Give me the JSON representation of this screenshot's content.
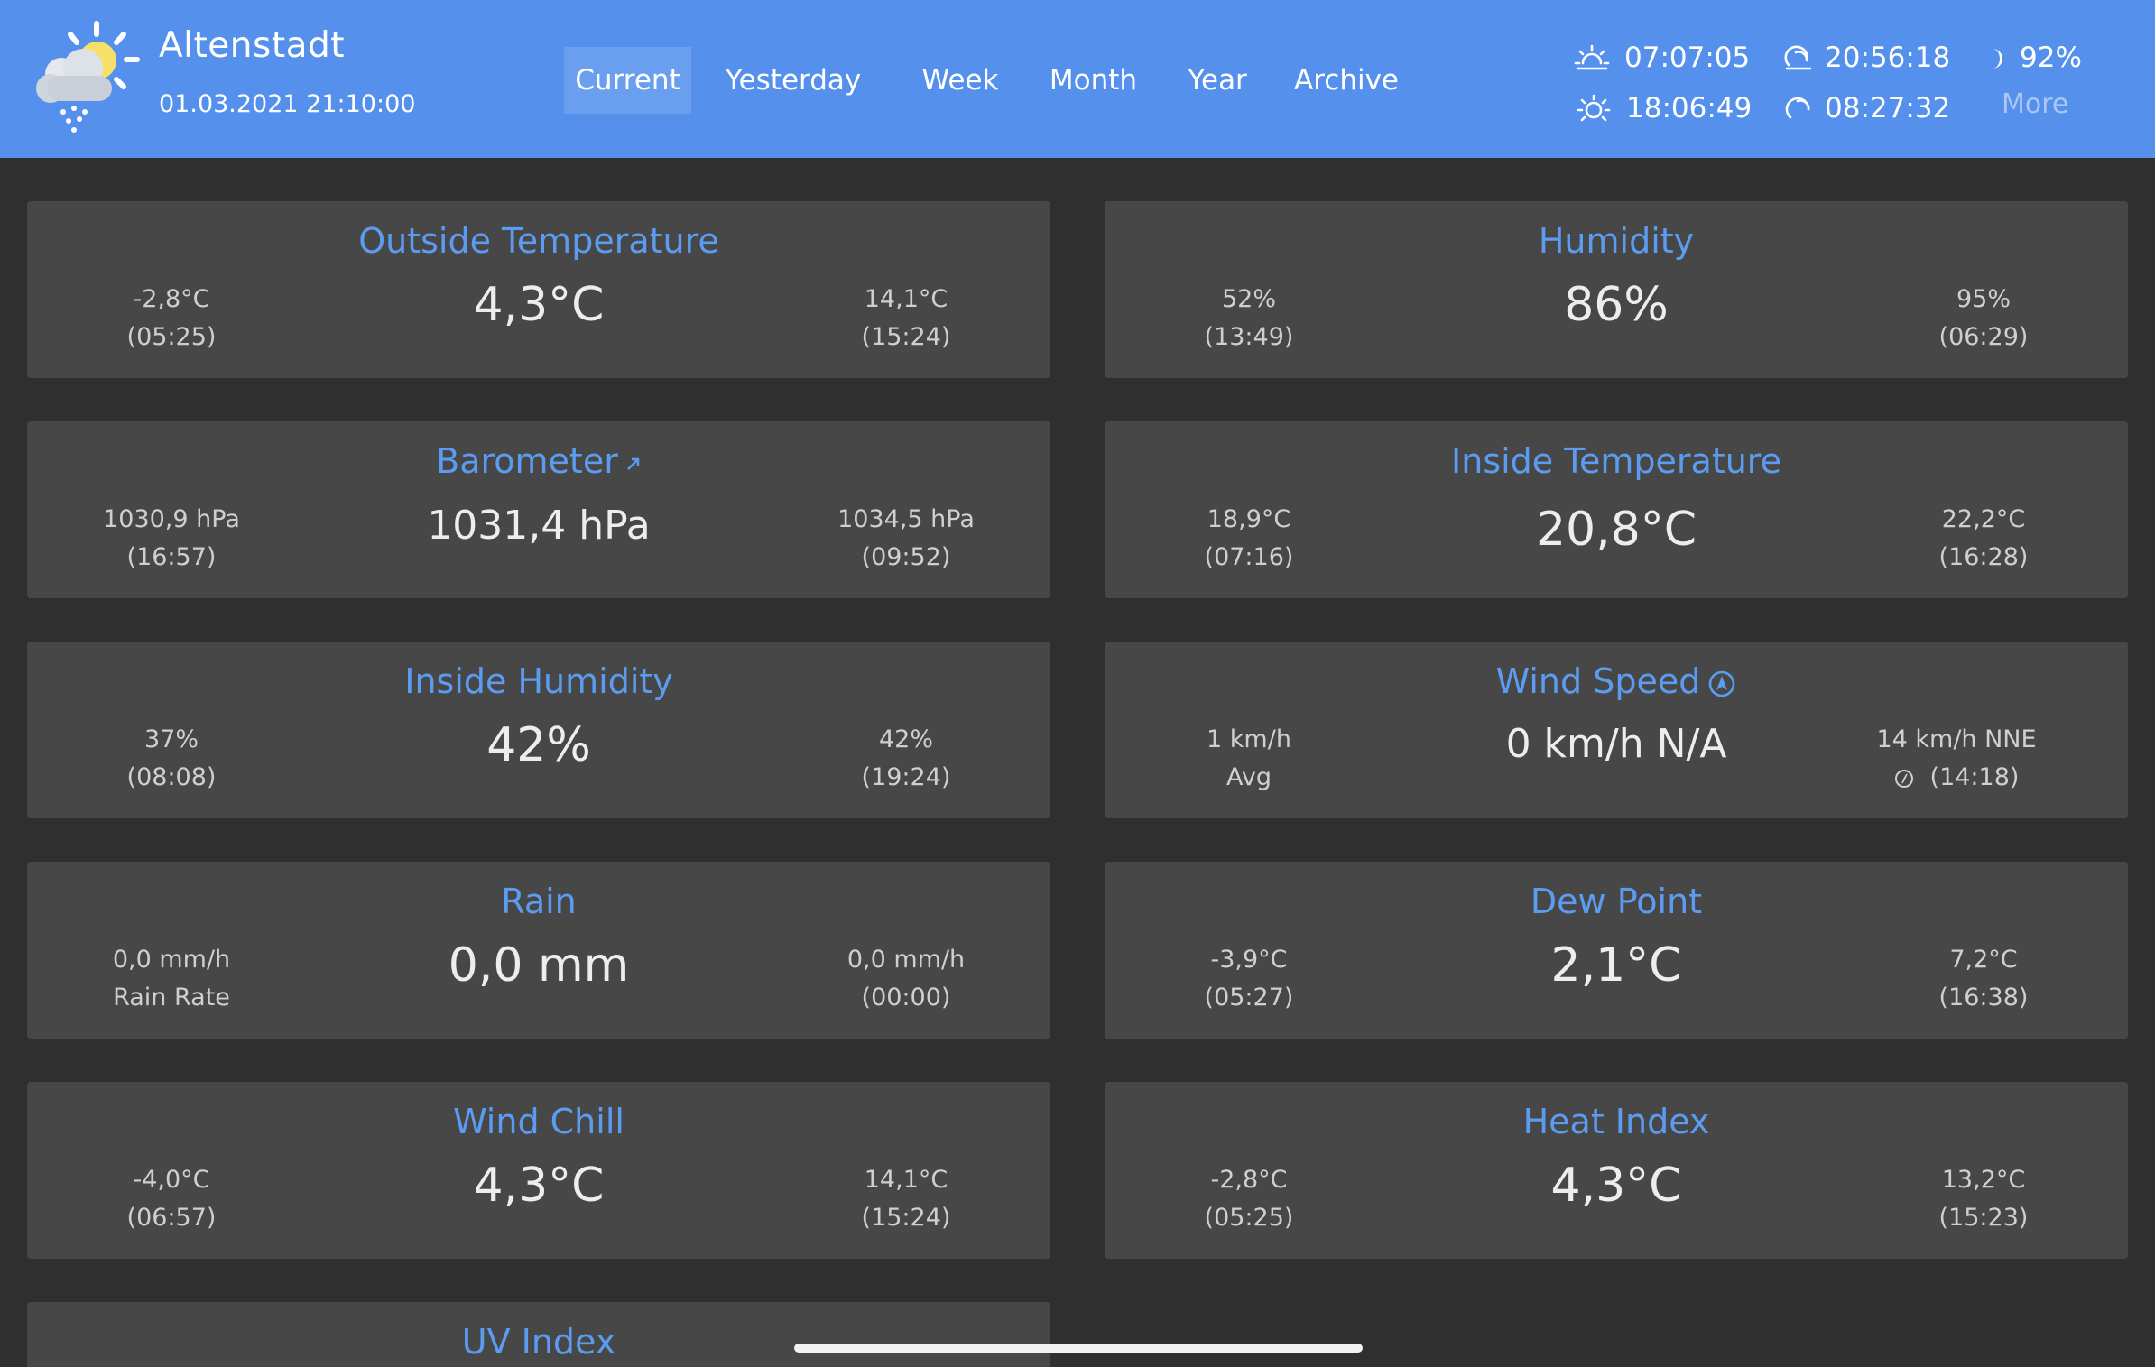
{
  "header": {
    "station": "Altenstadt",
    "datetime": "01.03.2021 21:10:00",
    "nav": [
      {
        "label": "Current",
        "active": true
      },
      {
        "label": "Yesterday",
        "active": false
      },
      {
        "label": "Week",
        "active": false
      },
      {
        "label": "Month",
        "active": false
      },
      {
        "label": "Year",
        "active": false
      },
      {
        "label": "Archive",
        "active": false
      }
    ],
    "astro": {
      "sunrise": "07:07:05",
      "sunset": "18:06:49",
      "moonrise": "20:56:18",
      "moonset": "08:27:32",
      "moon_phase": "92%",
      "more": "More"
    }
  },
  "cards": [
    {
      "title": "Outside Temperature",
      "value": "4,3°C",
      "left1": "-2,8°C",
      "left2": "(05:25)",
      "right1": "14,1°C",
      "right2": "(15:24)"
    },
    {
      "title": "Humidity",
      "value": "86%",
      "left1": "52%",
      "left2": "(13:49)",
      "right1": "95%",
      "right2": "(06:29)"
    },
    {
      "title": "Barometer",
      "value": "1031,4 hPa",
      "left1": "1030,9 hPa",
      "left2": "(16:57)",
      "right1": "1034,5 hPa",
      "right2": "(09:52)"
    },
    {
      "title": "Inside Temperature",
      "value": "20,8°C",
      "left1": "18,9°C",
      "left2": "(07:16)",
      "right1": "22,2°C",
      "right2": "(16:28)"
    },
    {
      "title": "Inside Humidity",
      "value": "42%",
      "left1": "37%",
      "left2": "(08:08)",
      "right1": "42%",
      "right2": "(19:24)"
    },
    {
      "title": "Wind Speed",
      "value": "0 km/h N/A",
      "left1": "1 km/h",
      "left2": "Avg",
      "right1": "14 km/h NNE",
      "right2": "(14:18)"
    },
    {
      "title": "Rain",
      "value": "0,0 mm",
      "left1": "0,0 mm/h",
      "left2": "Rain Rate",
      "right1": "0,0 mm/h",
      "right2": "(00:00)"
    },
    {
      "title": "Dew Point",
      "value": "2,1°C",
      "left1": "-3,9°C",
      "left2": "(05:27)",
      "right1": "7,2°C",
      "right2": "(16:38)"
    },
    {
      "title": "Wind Chill",
      "value": "4,3°C",
      "left1": "-4,0°C",
      "left2": "(06:57)",
      "right1": "14,1°C",
      "right2": "(15:24)"
    },
    {
      "title": "Heat Index",
      "value": "4,3°C",
      "left1": "-2,8°C",
      "left2": "(05:25)",
      "right1": "13,2°C",
      "right2": "(15:23)"
    },
    {
      "title": "UV Index"
    }
  ],
  "colors": {
    "header": "#5591ec",
    "background": "#2f2f2f",
    "card": "#474747",
    "title": "#5c9cf0"
  }
}
